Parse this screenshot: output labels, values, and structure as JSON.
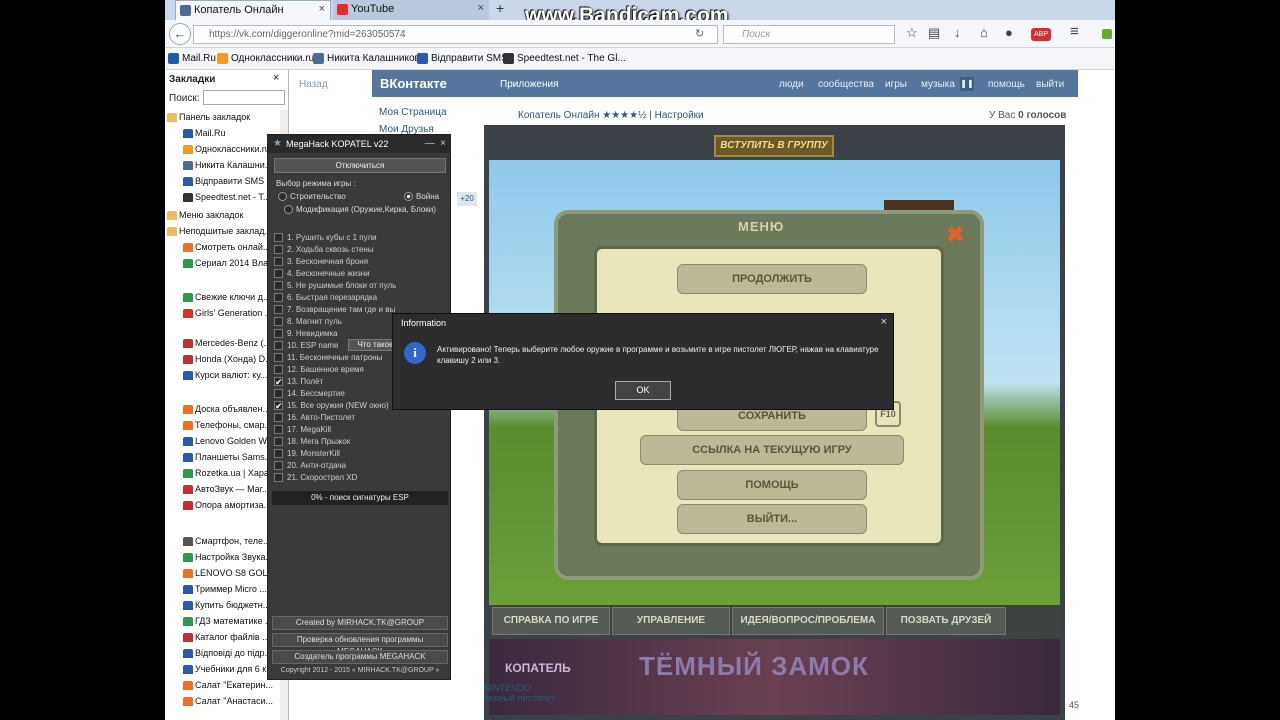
{
  "watermark": "www.Bandicam.com",
  "browser": {
    "tabs": [
      {
        "label": "Копатель Онлайн",
        "color": "#4a6b95"
      },
      {
        "label": "YouTube",
        "color": "#e52d27"
      }
    ],
    "url": "https://vk.com/diggeronline?mid=263050574",
    "search_placeholder": "Поиск",
    "adblock_label": "ABP",
    "bookmarks": [
      {
        "label": "Mail.Ru",
        "color": "#1f5ca8"
      },
      {
        "label": "Одноклассники.ru",
        "color": "#f59a1c"
      },
      {
        "label": "Никита Калашников",
        "color": "#4a6b95"
      },
      {
        "label": "Відправити SMS",
        "color": "#2a5ab0"
      },
      {
        "label": "Speedtest.net - The Gl...",
        "color": "#333"
      }
    ]
  },
  "sidebar": {
    "title": "Закладки",
    "search_label": "Поиск:",
    "items": [
      {
        "label": "Панель закладок",
        "folder": true,
        "color": "#e8c060"
      },
      {
        "label": "Mail.Ru",
        "color": "#1f5ca8"
      },
      {
        "label": "Одноклассники.ru",
        "color": "#f59a1c"
      },
      {
        "label": "Никита Калашни...",
        "color": "#4a6b95"
      },
      {
        "label": "Відправити SMS",
        "color": "#2a5ab0"
      },
      {
        "label": "Speedtest.net - T...",
        "color": "#333"
      },
      {
        "label": "Меню закладок",
        "folder": true,
        "color": "#e8c060"
      },
      {
        "label": "Неподшитые заклад...",
        "folder": true,
        "color": "#e8c060"
      },
      {
        "label": "Смотреть онлай...",
        "color": "#f07020"
      },
      {
        "label": "Сериал 2014 Вла...",
        "color": "#2a9a4a"
      },
      {
        "label": "Свежие ключи д...",
        "color": "#2a9a4a"
      },
      {
        "label": "Girls' Generation ...",
        "color": "#e52d27"
      },
      {
        "label": "Mercedes-Benz (...",
        "color": "#c43030"
      },
      {
        "label": "Honda (Хонда) D...",
        "color": "#c43030"
      },
      {
        "label": "Курси валют: ку...",
        "color": "#2a5ab0"
      },
      {
        "label": "Доска объявлен...",
        "color": "#f07020"
      },
      {
        "label": "Телефоны, смар...",
        "color": "#f07020"
      },
      {
        "label": "Lenovo Golden W...",
        "color": "#2a5ab0"
      },
      {
        "label": "Планшеты Sams...",
        "color": "#2a5ab0"
      },
      {
        "label": "Rozetka.ua | Хара...",
        "color": "#2a9a4a"
      },
      {
        "label": "АвтоЗвук — Маг...",
        "color": "#c43030"
      },
      {
        "label": "Опора амортиза...",
        "color": "#c43030"
      },
      {
        "label": "Смартфон, теле...",
        "color": "#555"
      },
      {
        "label": "Настройка Звука...",
        "color": "#2a9a4a"
      },
      {
        "label": "LENOVO S8 GOL...",
        "color": "#f07020"
      },
      {
        "label": "Триммер Micro ...",
        "color": "#2a5ab0"
      },
      {
        "label": "Купить бюджетн...",
        "color": "#2a5ab0"
      },
      {
        "label": "ГДЗ математике ...",
        "color": "#2a9a4a"
      },
      {
        "label": "Каталог файлів ...",
        "color": "#c43030"
      },
      {
        "label": "Відповіді до підр...",
        "color": "#2a5ab0"
      },
      {
        "label": "Учебники для 6 к...",
        "color": "#2a5ab0"
      },
      {
        "label": "Салат \"Екатерин...",
        "color": "#f07020"
      },
      {
        "label": "Салат \"Анастаси...",
        "color": "#f07020"
      }
    ]
  },
  "vk": {
    "back": "Назад",
    "logo": "ВКонтакте",
    "apps": "Приложения",
    "links": [
      "люди",
      "сообщества",
      "игры",
      "музыка",
      "помощь",
      "выйти"
    ],
    "menu": [
      "Моя Страница",
      "Мои Друзья"
    ],
    "plus_badge": "+20",
    "crumb": "Копатель Онлайн ★★★★½ | Настройки",
    "votes_prefix": "У Вас ",
    "votes_value": "0 голосов",
    "bottom_ad_1": "NINTENDO",
    "bottom_ad_2": "черный пистолет",
    "counter": "45"
  },
  "game": {
    "join": "ВСТУПИТЬ В ГРУППУ",
    "menu_title": "МЕНЮ",
    "menu_items": [
      "ПРОДОЛЖИТЬ",
      "СОХРАНИТЬ",
      "ССЫЛКА НА ТЕКУЩУЮ ИГРУ",
      "ПОМОЩЬ",
      "ВЫЙТИ..."
    ],
    "save_key": "F10",
    "tabs": [
      "СПРАВКА ПО ИГРЕ",
      "УПРАВЛЕНИЕ",
      "ИДЕЯ/ВОПРОС/ПРОБЛЕМА",
      "ПОЗВАТЬ ДРУЗЕЙ"
    ],
    "banner_small": "КОПАТЕЛЬ",
    "banner_big": "ТЁМНЫЙ ЗАМОК"
  },
  "megahack": {
    "title": "MegaHack KOPATEL v22",
    "off_button": "Отключиться",
    "mode_label": "Выбор режима игры :",
    "mode_build": "Строительство",
    "mode_war": "Война",
    "mode_mod": "Модификация (Оружие,Кирка, Блоки)",
    "options": [
      {
        "label": "1. Рушить кубы с 1 пули",
        "checked": false
      },
      {
        "label": "2. Ходьба сквозь стены",
        "checked": false
      },
      {
        "label": "3. Бесконечная броня",
        "checked": false
      },
      {
        "label": "4. Бесконечные жизни",
        "checked": false
      },
      {
        "label": "5. Не рушимые блоки от пуль",
        "checked": false
      },
      {
        "label": "6. Быстрая перезарядка",
        "checked": false
      },
      {
        "label": "7. Возвращение там где и вы",
        "checked": false
      },
      {
        "label": "8. Магнит пуль",
        "checked": false
      },
      {
        "label": "9. Невидимка",
        "checked": false
      },
      {
        "label": "10. ESP name",
        "checked": false
      },
      {
        "label": "11. Бесконечные патроны",
        "checked": false
      },
      {
        "label": "12. Башенное время",
        "checked": false
      },
      {
        "label": "13. Полёт",
        "checked": true
      },
      {
        "label": "14. Бессмертие",
        "checked": false
      },
      {
        "label": "15. Все оружия (NEW окно)",
        "checked": true
      },
      {
        "label": "16. Авто-Пистолет",
        "checked": false
      },
      {
        "label": "17. MegaKill",
        "checked": false
      },
      {
        "label": "18. Мега Прыжок",
        "checked": false
      },
      {
        "label": "19. MonsterKill",
        "checked": false
      },
      {
        "label": "20. Анти-отдача",
        "checked": false
      },
      {
        "label": "21. Скорострел XD",
        "checked": false
      }
    ],
    "esp_button": "Что такое",
    "status": "0% - поиск сигнатуры ESP",
    "footer": [
      "Created by MIRHACK.TK@GROUP",
      "Проверка обновления программы MEGAHACK",
      "Создатель программы MEGAHACK"
    ],
    "copyright": "Copyright 2012 - 2015 « MIRHACK.TK@GROUP »"
  },
  "dialog": {
    "title": "Information",
    "message": "Активировано! Теперь выберите любое оружие в программе и возьмите в игре пистолет ЛЮГЕР, нажав на клавиатуре клавишу 2 или 3.",
    "ok": "OK"
  }
}
